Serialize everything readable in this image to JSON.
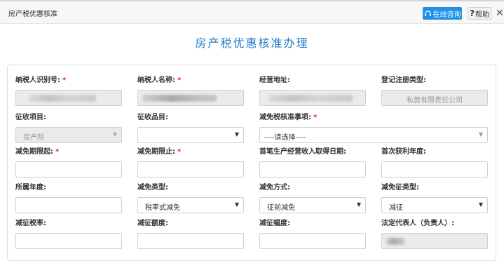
{
  "window": {
    "title": "房产税优惠核准",
    "consult_label": "在线咨询",
    "help_label": "帮助",
    "close_glyph": "✕"
  },
  "page": {
    "title": "房产税优惠核准办理"
  },
  "form": {
    "required_mark": "*",
    "taxpayer_id": {
      "label": "纳税人识别号:",
      "value": ""
    },
    "taxpayer_name": {
      "label": "纳税人名称:",
      "value": ""
    },
    "business_address": {
      "label": "经营地址:",
      "value": ""
    },
    "registration_type": {
      "label": "登记注册类型:",
      "value": "私营有限责任公司"
    },
    "levy_item": {
      "label": "征收项目:",
      "value": "房产税"
    },
    "levy_category": {
      "label": "征收品目:",
      "value": ""
    },
    "exemption_item": {
      "label": "减免税核准事项:",
      "value": "----请选择----"
    },
    "exemption_start": {
      "label": "减免期限起:",
      "value": ""
    },
    "exemption_end": {
      "label": "减免期限止:",
      "value": ""
    },
    "first_income_date": {
      "label": "首笔生产经营收入取得日期:",
      "value": ""
    },
    "first_profit_year": {
      "label": "首次获利年度:",
      "value": ""
    },
    "belong_year": {
      "label": "所属年度:",
      "value": ""
    },
    "exemption_type": {
      "label": "减免类型:",
      "value": "税率式减免"
    },
    "exemption_method": {
      "label": "减免方式:",
      "value": "征前减免"
    },
    "levy_reduction_type": {
      "label": "减免征类型:",
      "value": "减征"
    },
    "reduction_rate": {
      "label": "减征税率:",
      "value": ""
    },
    "reduction_amount": {
      "label": "减征额度:",
      "value": ""
    },
    "reduction_range": {
      "label": "减征幅度:",
      "value": ""
    },
    "legal_rep": {
      "label": "法定代表人（负责人）:",
      "value": ""
    }
  },
  "icons": {
    "consult": "headset-icon",
    "dropdown": "caret-down-icon",
    "close": "close-icon"
  },
  "colors": {
    "accent": "#1e90e6",
    "title": "#2a7cc7",
    "required": "#e02020",
    "disabled_bg": "#ebebeb"
  }
}
